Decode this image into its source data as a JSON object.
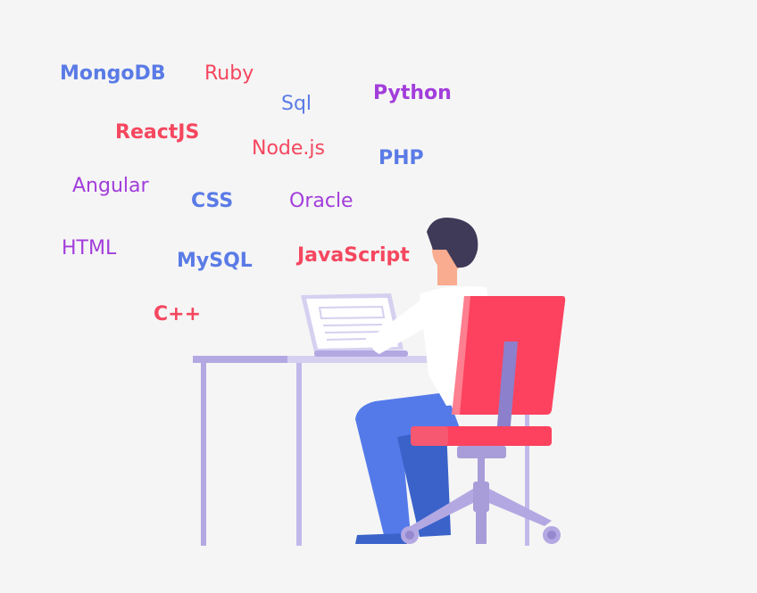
{
  "words": [
    {
      "text": "MongoDB",
      "color": "#5a7be6"
    },
    {
      "text": "Ruby",
      "color": "#f5475f"
    },
    {
      "text": "Sql",
      "color": "#5a7be6"
    },
    {
      "text": "Python",
      "color": "#a23ddb"
    },
    {
      "text": "ReactJS",
      "color": "#f5475f"
    },
    {
      "text": "Node.js",
      "color": "#f5475f"
    },
    {
      "text": "PHP",
      "color": "#5a7be6"
    },
    {
      "text": "Angular",
      "color": "#a23ddb"
    },
    {
      "text": "CSS",
      "color": "#5a7be6"
    },
    {
      "text": "Oracle",
      "color": "#a23ddb"
    },
    {
      "text": "HTML",
      "color": "#a23ddb"
    },
    {
      "text": "MySQL",
      "color": "#5a7be6"
    },
    {
      "text": "JavaScript",
      "color": "#f5475f"
    },
    {
      "text": "C++",
      "color": "#f5475f"
    }
  ],
  "illustration": {
    "subject": "developer-at-desk",
    "colors": {
      "chair": "#fc425e",
      "desk": "#b3a8e2",
      "pants": "#547aea",
      "hair": "#3f3a58",
      "skin": "#f9ac8f",
      "shirt": "#ffffff"
    }
  }
}
